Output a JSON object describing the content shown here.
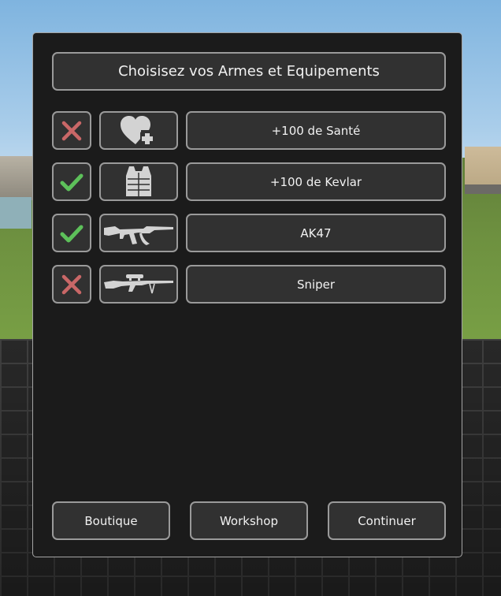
{
  "menu": {
    "title": "Choisisez vos Armes et Equipements",
    "items": [
      {
        "label": "+100 de Santé",
        "selected": false,
        "status_icon": "cross-icon",
        "item_icon": "heart-plus-icon"
      },
      {
        "label": "+100 de Kevlar",
        "selected": true,
        "status_icon": "check-icon",
        "item_icon": "kevlar-vest-icon"
      },
      {
        "label": "AK47",
        "selected": true,
        "status_icon": "check-icon",
        "item_icon": "ak47-rifle-icon"
      },
      {
        "label": "Sniper",
        "selected": false,
        "status_icon": "cross-icon",
        "item_icon": "sniper-rifle-icon"
      }
    ],
    "buttons": {
      "shop": "Boutique",
      "workshop": "Workshop",
      "continue": "Continuer"
    }
  },
  "colors": {
    "panel_bg": "#1b1b1b",
    "box_bg": "#313131",
    "box_border": "#9a9a9a",
    "check_green": "#5dc05a",
    "cross_red": "#c96767",
    "icon_gray": "#d3d3d3"
  }
}
